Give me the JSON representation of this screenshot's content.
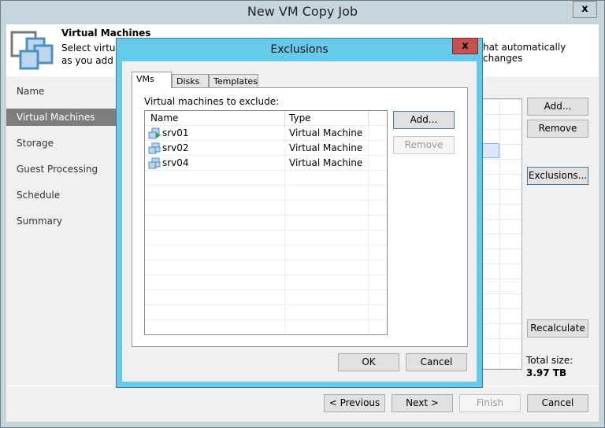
{
  "window": {
    "title": "New VM Copy Job",
    "close": "x"
  },
  "header": {
    "title": "Virtual Machines",
    "desc_line1": "Select virtual",
    "desc_right": "hat automatically changes",
    "desc_line2": "as you add n"
  },
  "nav": [
    "Name",
    "Virtual Machines",
    "Storage",
    "Guest Processing",
    "Schedule",
    "Summary"
  ],
  "main_buttons": {
    "add": "Add...",
    "remove": "Remove",
    "exclusions": "Exclusions...",
    "recalculate": "Recalculate"
  },
  "total": {
    "label": "Total size:",
    "value": "3.97 TB"
  },
  "footer": {
    "previous": "< Previous",
    "next": "Next >",
    "finish": "Finish",
    "cancel": "Cancel"
  },
  "dialog": {
    "title": "Exclusions",
    "close": "x",
    "tabs": [
      "VMs",
      "Disks",
      "Templates"
    ],
    "label": "Virtual machines to exclude:",
    "columns": [
      "Name",
      "Type"
    ],
    "rows": [
      {
        "name": "srv01",
        "type": "Virtual Machine",
        "running": true
      },
      {
        "name": "srv02",
        "type": "Virtual Machine"
      },
      {
        "name": "srv04",
        "type": "Virtual Machine"
      }
    ],
    "add": "Add...",
    "remove": "Remove",
    "ok": "OK",
    "cancel": "Cancel"
  }
}
